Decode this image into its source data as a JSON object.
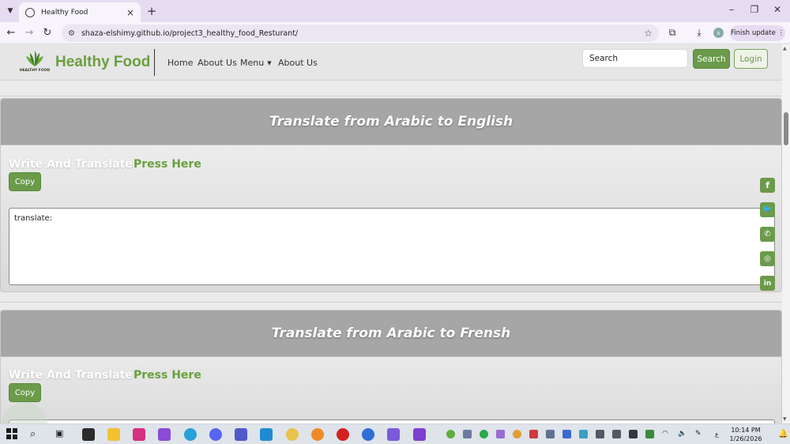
{
  "browser": {
    "tab_title": "Healthy Food",
    "url": "shaza-elshimy.github.io/project3_healthy_food_Resturant/",
    "profile_initial": "s",
    "finish_update_label": "Finish update"
  },
  "site": {
    "logo_text": "HEALTHY FOOD",
    "brand": "Healthy Food",
    "nav": [
      "Home",
      "About Us",
      "Menu",
      "About Us"
    ],
    "search_placeholder": "Search",
    "search_button": "Search",
    "login_button": "Login"
  },
  "sections": [
    {
      "heading": "Translate from Arabic to English",
      "write_label": "Write And Translate",
      "press_label": "Press Here",
      "copy_label": "Copy",
      "textarea_value": "translate:"
    },
    {
      "heading": "Translate from Arabic to Frensh",
      "write_label": "Write And Translate",
      "press_label": "Press Here",
      "copy_label": "Copy"
    }
  ],
  "social_icons": [
    "facebook-icon",
    "twitter-icon",
    "whatsapp-icon",
    "instagram-icon",
    "linkedin-icon"
  ],
  "taskbar": {
    "time": "10:14 PM",
    "date": "1/26/2026",
    "lang": "ع"
  },
  "colors": {
    "brand_green": "#6a9f3e",
    "button_green": "#6b9a4a",
    "section_header_gray": "#a6a6a6"
  }
}
